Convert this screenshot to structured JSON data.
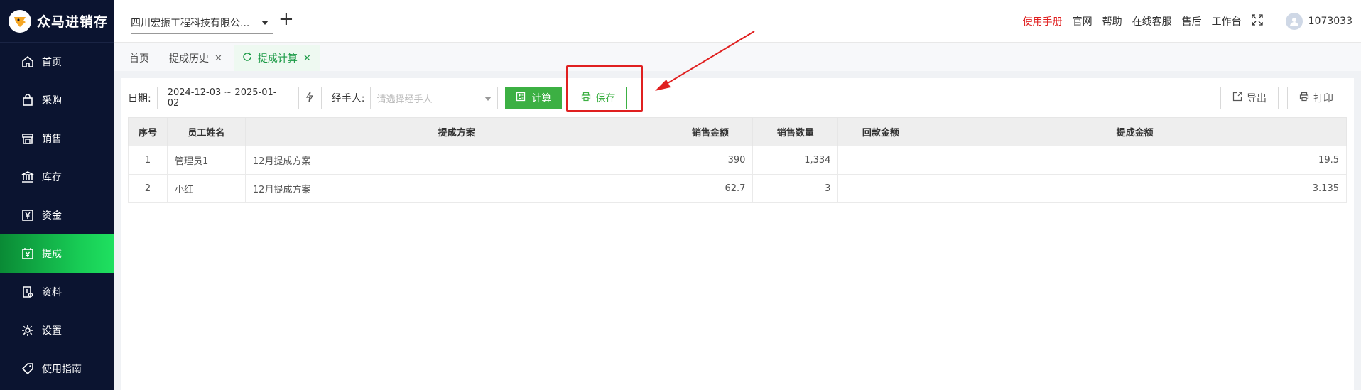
{
  "app": {
    "name": "众马进销存"
  },
  "sidebar": {
    "items": [
      {
        "label": "首页",
        "icon": "home-icon"
      },
      {
        "label": "采购",
        "icon": "bag-icon"
      },
      {
        "label": "销售",
        "icon": "store-icon"
      },
      {
        "label": "库存",
        "icon": "bank-icon"
      },
      {
        "label": "资金",
        "icon": "yuan-icon"
      },
      {
        "label": "提成",
        "icon": "calendar-yuan-icon",
        "active": true
      },
      {
        "label": "资料",
        "icon": "document-icon"
      },
      {
        "label": "设置",
        "icon": "gear-icon"
      },
      {
        "label": "使用指南",
        "icon": "tag-icon"
      }
    ]
  },
  "header": {
    "company": "四川宏振工程科技有限公...",
    "links": [
      "使用手册",
      "官网",
      "帮助",
      "在线客服",
      "售后",
      "工作台"
    ],
    "user_id": "1073033"
  },
  "tabs": [
    {
      "label": "首页",
      "closable": false
    },
    {
      "label": "提成历史",
      "closable": true
    },
    {
      "label": "提成计算",
      "closable": true,
      "active": true
    }
  ],
  "filter": {
    "date_label": "日期:",
    "date_range": "2024-12-03 ~ 2025-01-02",
    "handler_label": "经手人:",
    "handler_placeholder": "请选择经手人",
    "calc_label": "计算",
    "save_label": "保存",
    "export_label": "导出",
    "print_label": "打印"
  },
  "table": {
    "headers": [
      "序号",
      "员工姓名",
      "提成方案",
      "销售金额",
      "销售数量",
      "回款金额",
      "提成金额"
    ],
    "rows": [
      [
        "1",
        "管理员1",
        "12月提成方案",
        "390",
        "1,334",
        "",
        "19.5"
      ],
      [
        "2",
        "小红",
        "12月提成方案",
        "62.7",
        "3",
        "",
        "3.135"
      ]
    ]
  },
  "colors": {
    "sidebar_bg": "#0b1430",
    "accent_green": "#3cb043",
    "highlight_red": "#e02020"
  }
}
